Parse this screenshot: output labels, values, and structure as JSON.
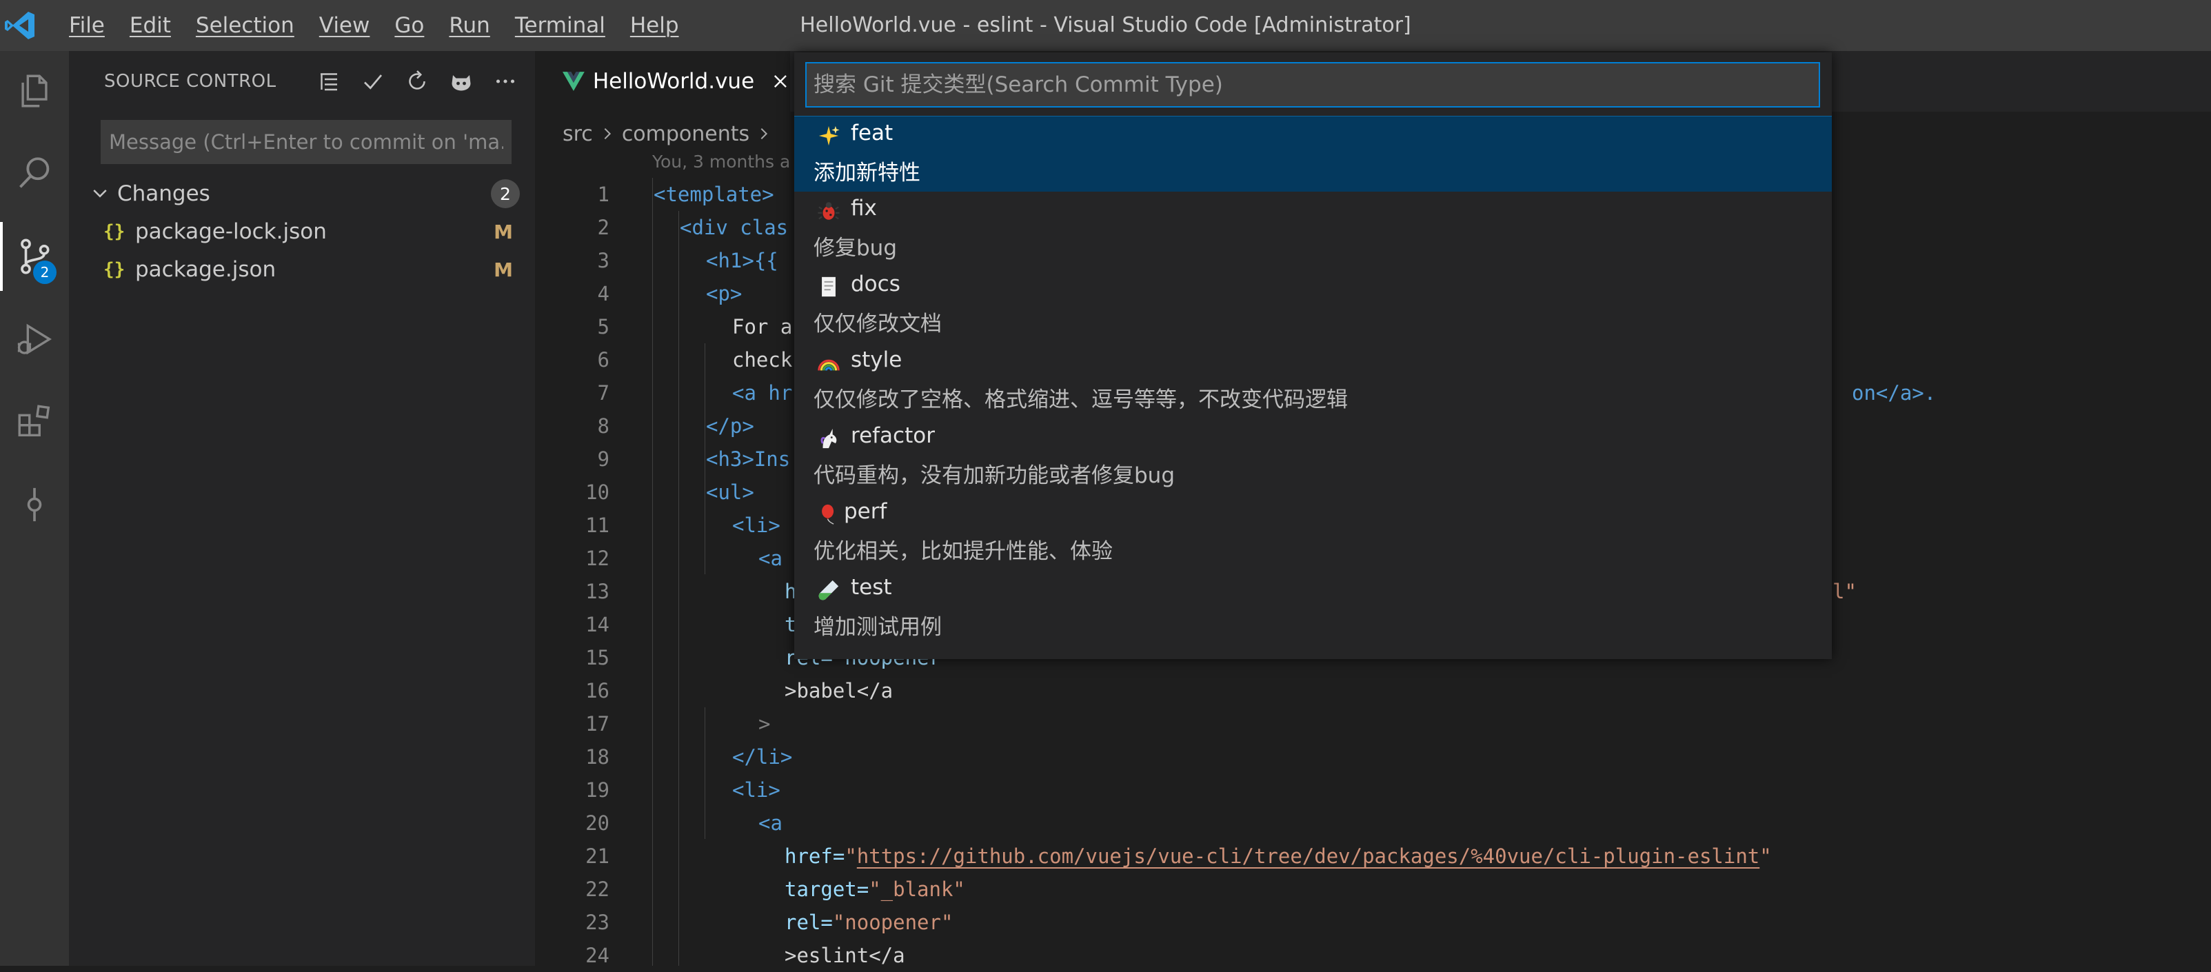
{
  "window": {
    "title": "HelloWorld.vue - eslint - Visual Studio Code [Administrator]",
    "menu": [
      "File",
      "Edit",
      "Selection",
      "View",
      "Go",
      "Run",
      "Terminal",
      "Help"
    ]
  },
  "activity_bar": {
    "items": [
      "explorer-icon",
      "search-icon",
      "source-control-icon",
      "run-debug-icon",
      "extensions-icon",
      "git-commit-icon"
    ],
    "active": "source-control-icon",
    "source_control_badge": "2"
  },
  "sidebar": {
    "title": "SOURCE CONTROL",
    "actions": [
      "view-as-tree-icon",
      "commit-check-icon",
      "refresh-icon",
      "git-emoji-icon",
      "more-actions-icon"
    ],
    "commit_placeholder": "Message (Ctrl+Enter to commit on 'ma...",
    "changes": {
      "label": "Changes",
      "count": "2",
      "files": [
        {
          "icon": "{}",
          "name": "package-lock.json",
          "status": "M"
        },
        {
          "icon": "{}",
          "name": "package.json",
          "status": "M"
        }
      ]
    }
  },
  "editor": {
    "tab": {
      "label": "HelloWorld.vue",
      "icon": "vue-icon"
    },
    "breadcrumb": [
      "src",
      "components"
    ],
    "blame": "You, 3 months a",
    "line_numbers": [
      "1",
      "2",
      "3",
      "4",
      "5",
      "6",
      "7",
      "8",
      "9",
      "10",
      "11",
      "12",
      "13",
      "14",
      "15",
      "16",
      "17",
      "18",
      "19",
      "20",
      "21",
      "22",
      "23",
      "24"
    ],
    "visible_code": {
      "l1": "<template>",
      "l2": "<div clas",
      "l3": "<h1>{{",
      "l4": "<p>",
      "l5": "For a",
      "l6": "check",
      "l7a": "<a hr",
      "l7b": "on</a>.",
      "l8": "</p>",
      "l9": "<h3>Ins",
      "l10": "<ul>",
      "l11": "<li>",
      "l12": "<a",
      "l13a": "h",
      "l13b": "l\"",
      "l14": "t",
      "l15": "rel=\"noopener\"",
      "l16": ">babel</a",
      "l17": ">",
      "l18": "</li>",
      "l19": "<li>",
      "l20": "<a",
      "l21_attr": "href=",
      "l21_url": "https://github.com/vuejs/vue-cli/tree/dev/packages/%40vue/cli-plugin-eslint",
      "l22_attr": "target=",
      "l22_val": "\"_blank\"",
      "l23_attr": "rel=",
      "l23_val": "\"noopener\"",
      "l24": ">eslint</a"
    }
  },
  "quick_pick": {
    "placeholder": "搜索 Git 提交类型(Search Commit Type)",
    "items": [
      {
        "emoji": "sparkles-icon",
        "label": "feat",
        "description": "添加新特性"
      },
      {
        "emoji": "bug-icon",
        "label": "fix",
        "description": "修复bug"
      },
      {
        "emoji": "memo-icon",
        "label": "docs",
        "description": "仅仅修改文档"
      },
      {
        "emoji": "rainbow-icon",
        "label": "style",
        "description": "仅仅修改了空格、格式缩进、逗号等等，不改变代码逻辑"
      },
      {
        "emoji": "unicorn-icon",
        "label": "refactor",
        "description": "代码重构，没有加新功能或者修复bug"
      },
      {
        "emoji": "balloon-icon",
        "label": "perf",
        "description": "优化相关，比如提升性能、体验"
      },
      {
        "emoji": "test-tube-icon",
        "label": "test",
        "description": "增加测试用例"
      }
    ],
    "selected_index": 0
  },
  "colors": {
    "accent": "#007acc",
    "selection": "#04395e",
    "modified": "#c9a56a",
    "json_icon": "#cbcb41",
    "vue_green": "#41b883"
  }
}
